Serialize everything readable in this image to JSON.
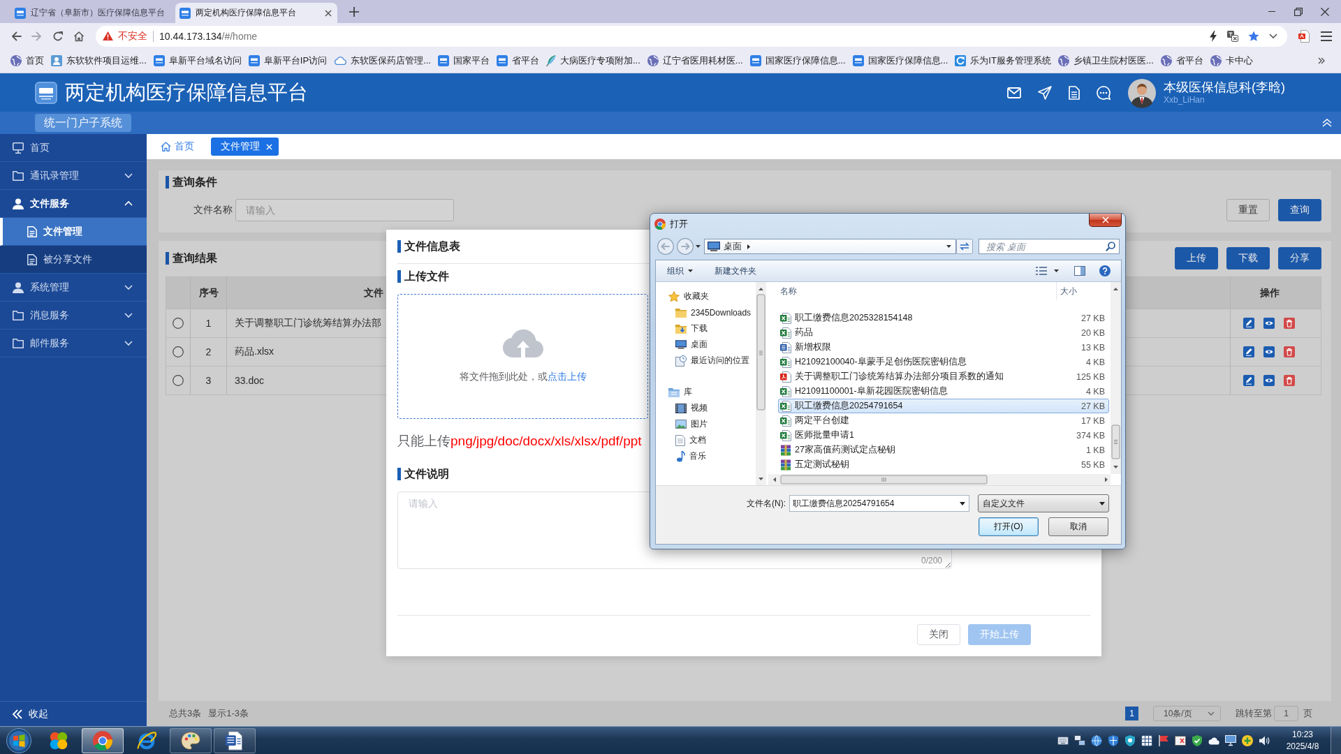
{
  "browser": {
    "tabs": [
      {
        "title": "辽宁省（阜新市）医疗保障信息平台",
        "selected": false
      },
      {
        "title": "两定机构医疗保障信息平台",
        "selected": true
      }
    ],
    "address": {
      "security": "不安全",
      "host": "10.44.173.134",
      "path": "/#/home"
    },
    "bookmarks": [
      {
        "label": "首页",
        "kind": "globe"
      },
      {
        "label": "东软软件项目运维...",
        "kind": "contact"
      },
      {
        "label": "阜新平台域名访问",
        "kind": "logo"
      },
      {
        "label": "阜新平台IP访问",
        "kind": "logo"
      },
      {
        "label": "东软医保药店管理...",
        "kind": "cloud"
      },
      {
        "label": "国家平台",
        "kind": "logo"
      },
      {
        "label": "省平台",
        "kind": "logo"
      },
      {
        "label": "大病医疗专项附加...",
        "kind": "feather"
      },
      {
        "label": "辽宁省医用耗材医...",
        "kind": "globe"
      },
      {
        "label": "国家医疗保障信息...",
        "kind": "logo"
      },
      {
        "label": "国家医疗保障信息...",
        "kind": "logo"
      },
      {
        "label": "乐为IT服务管理系统",
        "kind": "arc"
      },
      {
        "label": "乡镇卫生院村医医...",
        "kind": "globe"
      },
      {
        "label": "省平台",
        "kind": "globe"
      },
      {
        "label": "卡中心",
        "kind": "globe"
      }
    ]
  },
  "app": {
    "title": "两定机构医疗保障信息平台",
    "subsystem": "统一门户子系统",
    "user": {
      "name": "本级医保信息科(李晗)",
      "account": "Xxb_LiHan"
    },
    "sidebar": {
      "items": [
        {
          "label": "首页",
          "kind": "link"
        },
        {
          "label": "通讯录管理",
          "kind": "group",
          "expanded": false
        },
        {
          "label": "文件服务",
          "kind": "group",
          "expanded": true,
          "children": [
            {
              "label": "文件管理",
              "selected": true
            },
            {
              "label": "被分享文件",
              "selected": false
            }
          ]
        },
        {
          "label": "系统管理",
          "kind": "group",
          "expanded": false
        },
        {
          "label": "消息服务",
          "kind": "group",
          "expanded": false
        },
        {
          "label": "邮件服务",
          "kind": "group",
          "expanded": false
        }
      ],
      "collapse": "收起"
    },
    "tabs": [
      {
        "label": "首页",
        "selected": false,
        "closable": false
      },
      {
        "label": "文件管理",
        "selected": true,
        "closable": true
      }
    ],
    "query": {
      "title": "查询条件",
      "field": {
        "label": "文件名称",
        "placeholder": "请输入"
      },
      "buttons": [
        {
          "label": "重置",
          "primary": false
        },
        {
          "label": "查询",
          "primary": true
        }
      ]
    },
    "results": {
      "title": "查询结果",
      "buttons": [
        {
          "label": "上传",
          "primary": true
        },
        {
          "label": "下载",
          "primary": true
        },
        {
          "label": "分享",
          "primary": true
        }
      ],
      "table": {
        "columns": [
          "序号",
          "文件",
          "操作"
        ],
        "rows": [
          {
            "selected": false,
            "index": "1",
            "name": "关于调整职工门诊统筹结算办法部"
          },
          {
            "selected": false,
            "index": "2",
            "name": "药品.xlsx"
          },
          {
            "selected": false,
            "index": "3",
            "name": "33.doc"
          }
        ]
      },
      "footer": {
        "total": "总共3条",
        "range": "显示1-3条"
      },
      "pagination": {
        "pages": [
          {
            "label": "1",
            "selected": true
          }
        ],
        "page_size": "10条/页",
        "jump_label": "跳转至第",
        "jump_value": "1",
        "jump_suffix": "页"
      }
    }
  },
  "upload_dialog": {
    "title": "文件信息表",
    "upload_title": "上传文件",
    "drop_text": "将文件拖到此处，或",
    "drop_link": "点击上传",
    "hint": {
      "text": "只能上传",
      "formats": "png/jpg/doc/docx/xls/xlsx/pdf/ppt"
    },
    "description_title": "文件说明",
    "description": {
      "placeholder": "请输入",
      "counter": "0/200"
    },
    "buttons": [
      {
        "label": "关闭",
        "primary": false,
        "disabled": false
      },
      {
        "label": "开始上传",
        "primary": true,
        "disabled": true
      }
    ]
  },
  "open_dialog": {
    "title": "打开",
    "location": "桌面",
    "search": {
      "placeholder": "搜索 桌面"
    },
    "toolbar": [
      "组织",
      "新建文件夹"
    ],
    "nav": [
      {
        "label": "收藏夹",
        "children": [
          {
            "label": "2345Downloads"
          },
          {
            "label": "下载"
          },
          {
            "label": "桌面"
          },
          {
            "label": "最近访问的位置"
          }
        ]
      },
      {
        "label": "库",
        "children": [
          {
            "label": "视频"
          },
          {
            "label": "图片"
          },
          {
            "label": "文档"
          },
          {
            "label": "音乐"
          }
        ]
      }
    ],
    "columns": [
      "名称",
      "大小"
    ],
    "files": [
      {
        "name": "职工缴费信息2025328154148",
        "size": "27 KB",
        "kind": "sheet",
        "selected": false
      },
      {
        "name": "药品",
        "size": "20 KB",
        "kind": "sheet",
        "selected": false
      },
      {
        "name": "新增权限",
        "size": "13 KB",
        "kind": "doc",
        "selected": false
      },
      {
        "name": "H21092100040-阜蒙手足创伤医院密钥信息",
        "size": "4 KB",
        "kind": "sheet",
        "selected": false
      },
      {
        "name": "关于调整职工门诊统筹结算办法部分项目系数的通知",
        "size": "125 KB",
        "kind": "pdf",
        "selected": false
      },
      {
        "name": "H21091100001-阜新花园医院密钥信息",
        "size": "4 KB",
        "kind": "sheet",
        "selected": false
      },
      {
        "name": "职工缴费信息20254791654",
        "size": "27 KB",
        "kind": "sheet",
        "selected": true
      },
      {
        "name": "两定平台创建",
        "size": "17 KB",
        "kind": "sheet",
        "selected": false
      },
      {
        "name": "医师批量申请1",
        "size": "374 KB",
        "kind": "sheet",
        "selected": false
      },
      {
        "name": "27家高值药测试定点秘钥",
        "size": "1 KB",
        "kind": "archive",
        "selected": false
      },
      {
        "name": "五定测试秘钥",
        "size": "55 KB",
        "kind": "archive",
        "selected": false
      }
    ],
    "filename_label": "文件名(N):",
    "filename": "职工缴费信息20254791654",
    "filetype": "自定义文件",
    "buttons": [
      {
        "label": "打开(O)",
        "default": true
      },
      {
        "label": "取消",
        "default": false
      }
    ]
  },
  "taskbar": {
    "apps": [
      {
        "kind": "petals",
        "open": false,
        "selected": false
      },
      {
        "kind": "browser",
        "open": true,
        "selected": true
      },
      {
        "kind": "ring",
        "open": false,
        "selected": false
      },
      {
        "kind": "palette",
        "open": true,
        "selected": false
      },
      {
        "kind": "document",
        "open": true,
        "selected": false
      }
    ],
    "time": "10:23",
    "date": "2025/4/8"
  }
}
